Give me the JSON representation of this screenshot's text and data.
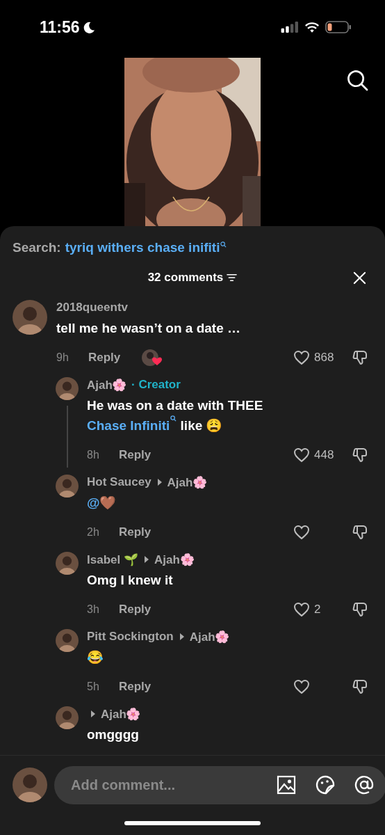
{
  "status_bar": {
    "time": "11:56",
    "do_not_disturb": true
  },
  "search": {
    "label": "Search:",
    "query": "tyriq withers chase inifiti"
  },
  "comments_header": {
    "count_label": "32 comments"
  },
  "comments": [
    {
      "user": "2018queentv",
      "body": [
        {
          "kind": "text",
          "text": "tell me he wasn’t on a date …"
        }
      ],
      "time": "9h",
      "reply_label": "Reply",
      "likes": "868",
      "liked_by_creator": true,
      "children": [
        {
          "user": "Ajah🌸",
          "creator_label": "· Creator",
          "body": [
            {
              "kind": "text",
              "text": "He was on a date with THEE "
            },
            {
              "kind": "search_link",
              "text": "Chase Infiniti"
            },
            {
              "kind": "text",
              "text": " like 😩"
            }
          ],
          "time": "8h",
          "reply_label": "Reply",
          "likes": "448"
        },
        {
          "user": "Hot Saucey",
          "reply_to": "Ajah🌸",
          "body": [
            {
              "kind": "mention",
              "text": "@"
            },
            {
              "kind": "text",
              "text": "🤎"
            }
          ],
          "time": "2h",
          "reply_label": "Reply"
        },
        {
          "user": "Isabel 🌱",
          "reply_to": "Ajah🌸",
          "body": [
            {
              "kind": "text",
              "text": "Omg I knew it"
            }
          ],
          "time": "3h",
          "reply_label": "Reply",
          "likes": "2"
        },
        {
          "user": "Pitt Sockington",
          "reply_to": "Ajah🌸",
          "body": [
            {
              "kind": "text",
              "text": "😂"
            }
          ],
          "time": "5h",
          "reply_label": "Reply"
        },
        {
          "reply_to": "Ajah🌸",
          "body": [
            {
              "kind": "text",
              "text": "omgggg"
            }
          ]
        }
      ]
    }
  ],
  "composer": {
    "placeholder": "Add comment..."
  }
}
